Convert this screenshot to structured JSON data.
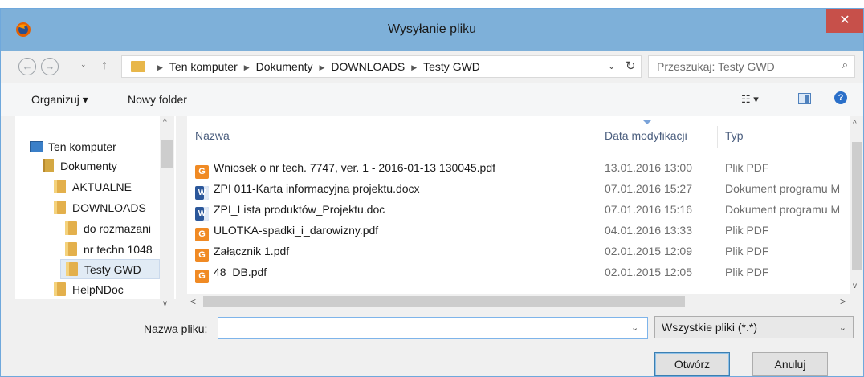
{
  "window": {
    "title": "Wysyłanie pliku",
    "close_glyph": "✕"
  },
  "address": {
    "back_glyph": "←",
    "forward_glyph": "→",
    "history_glyph": "⌄",
    "up_glyph": "↑",
    "crumbs": [
      "Ten komputer",
      "Dokumenty",
      "DOWNLOADS",
      "Testy GWD"
    ],
    "crumb_sep": "▶",
    "drop_glyph": "⌄",
    "refresh_glyph": "↻",
    "search_placeholder": "Przeszukaj: Testy GWD",
    "search_glyph": "⌕"
  },
  "toolbar": {
    "organize_label": "Organizuj ▾",
    "new_folder_label": "Nowy folder",
    "view_glyph": "☷ ▾",
    "help_glyph": "?"
  },
  "tree": {
    "items": [
      {
        "label": "Ten komputer",
        "icon": "computer-icon"
      },
      {
        "label": "Dokumenty",
        "icon": "documents-icon"
      },
      {
        "label": "AKTUALNE",
        "icon": "folder-icon"
      },
      {
        "label": "DOWNLOADS",
        "icon": "folder-icon"
      },
      {
        "label": "do rozmazani",
        "icon": "folder-icon"
      },
      {
        "label": "nr techn 1048",
        "icon": "folder-icon"
      },
      {
        "label": "Testy GWD",
        "icon": "folder-icon",
        "selected": true
      },
      {
        "label": "HelpNDoc",
        "icon": "folder-icon"
      }
    ],
    "scroll_up_glyph": "^",
    "scroll_down_glyph": "v"
  },
  "files": {
    "columns": {
      "name": "Nazwa",
      "date": "Data modyfikacji",
      "type": "Typ"
    },
    "rows": [
      {
        "name": "Wniosek o nr tech. 7747, ver. 1 - 2016-01-13 130045.pdf",
        "date": "13.01.2016 13:00",
        "type": "Plik PDF",
        "icon": "pdf-icon"
      },
      {
        "name": "ZPI 011-Karta informacyjna projektu.docx",
        "date": "07.01.2016 15:27",
        "type": "Dokument programu M",
        "icon": "word-icon"
      },
      {
        "name": "ZPI_Lista produktów_Projektu.doc",
        "date": "07.01.2016 15:16",
        "type": "Dokument programu M",
        "icon": "word-icon"
      },
      {
        "name": "ULOTKA-spadki_i_darowizny.pdf",
        "date": "04.01.2016 13:33",
        "type": "Plik PDF",
        "icon": "pdf-icon"
      },
      {
        "name": "Załącznik 1.pdf",
        "date": "02.01.2015 12:09",
        "type": "Plik PDF",
        "icon": "pdf-icon"
      },
      {
        "name": "48_DB.pdf",
        "date": "02.01.2015 12:05",
        "type": "Plik PDF",
        "icon": "pdf-icon"
      }
    ],
    "pdf_glyph": "G",
    "word_glyph": "W",
    "scroll_up_glyph": "^",
    "scroll_down_glyph": "v",
    "scroll_left_glyph": "<",
    "scroll_right_glyph": ">"
  },
  "footer": {
    "filename_label": "Nazwa pliku:",
    "filename_value": "",
    "filename_drop_glyph": "⌄",
    "filter_label": "Wszystkie pliki (*.*)",
    "filter_drop_glyph": "⌄",
    "open_label": "Otwórz",
    "cancel_label": "Anuluj"
  },
  "colors": {
    "titlebar": "#7eb0d9",
    "close": "#c7504a",
    "folder": "#e3b04c",
    "pdf": "#f08a24",
    "word": "#2b579a",
    "selection": "#e1ebf5"
  }
}
